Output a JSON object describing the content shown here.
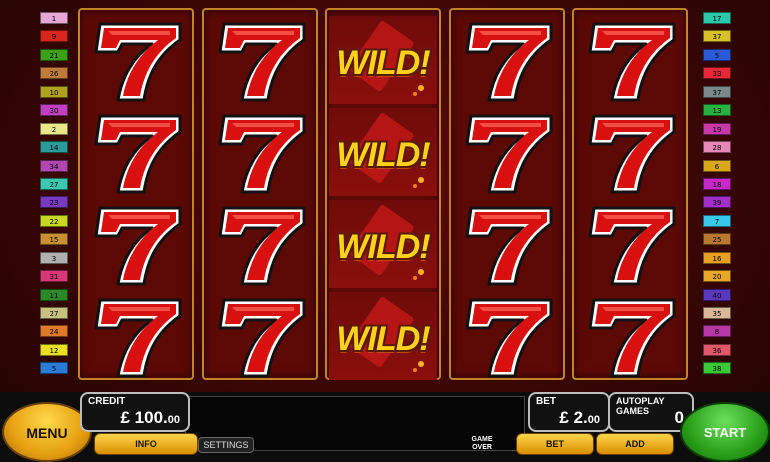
{
  "paylines": {
    "left": [
      {
        "n": "1",
        "c": "#e6a8d6"
      },
      {
        "n": "9",
        "c": "#d8261c"
      },
      {
        "n": "21",
        "c": "#3aa018"
      },
      {
        "n": "26",
        "c": "#c07a3a"
      },
      {
        "n": "10",
        "c": "#b0a020"
      },
      {
        "n": "30",
        "c": "#c040c0"
      },
      {
        "n": "2",
        "c": "#e8e88a"
      },
      {
        "n": "14",
        "c": "#2a9a9a"
      },
      {
        "n": "34",
        "c": "#b048b0"
      },
      {
        "n": "27",
        "c": "#3ac8b0"
      },
      {
        "n": "23",
        "c": "#7a3ac0"
      },
      {
        "n": "22",
        "c": "#c8d820"
      },
      {
        "n": "15",
        "c": "#c89030"
      },
      {
        "n": "3",
        "c": "#b0b0b0"
      },
      {
        "n": "31",
        "c": "#d83878"
      },
      {
        "n": "11",
        "c": "#2a8a2a"
      },
      {
        "n": "27",
        "c": "#c8c080"
      },
      {
        "n": "24",
        "c": "#e07a28"
      },
      {
        "n": "12",
        "c": "#e8e020"
      },
      {
        "n": "5",
        "c": "#2a7ad8"
      }
    ],
    "right": [
      {
        "n": "17",
        "c": "#2ac8a8"
      },
      {
        "n": "37",
        "c": "#d8c028"
      },
      {
        "n": "5",
        "c": "#2a5ad8"
      },
      {
        "n": "33",
        "c": "#e82838"
      },
      {
        "n": "37",
        "c": "#7a8a8a"
      },
      {
        "n": "13",
        "c": "#28b040"
      },
      {
        "n": "19",
        "c": "#c838a8"
      },
      {
        "n": "28",
        "c": "#e888b8"
      },
      {
        "n": "6",
        "c": "#d8a818"
      },
      {
        "n": "18",
        "c": "#c828c8"
      },
      {
        "n": "39",
        "c": "#a030c8"
      },
      {
        "n": "7",
        "c": "#38c8e8"
      },
      {
        "n": "25",
        "c": "#b87830"
      },
      {
        "n": "16",
        "c": "#e8a020"
      },
      {
        "n": "20",
        "c": "#e8a828"
      },
      {
        "n": "40",
        "c": "#5a38c0"
      },
      {
        "n": "35",
        "c": "#d8b898"
      },
      {
        "n": "8",
        "c": "#b838a8"
      },
      {
        "n": "36",
        "c": "#e0586a"
      },
      {
        "n": "38",
        "c": "#38c838"
      }
    ]
  },
  "reels": [
    [
      "seven",
      "seven",
      "seven",
      "seven"
    ],
    [
      "seven",
      "seven",
      "seven",
      "seven"
    ],
    [
      "wild",
      "wild",
      "wild",
      "wild"
    ],
    [
      "seven",
      "seven",
      "seven",
      "seven"
    ],
    [
      "seven",
      "seven",
      "seven",
      "seven"
    ]
  ],
  "symbols": {
    "wild_text": "WILD!"
  },
  "controls": {
    "menu": "MENU",
    "info": "INFO",
    "settings": "SETTINGS",
    "credit_label": "CREDIT",
    "credit_currency": "£",
    "credit_main": "100.",
    "credit_cents": "00",
    "game_over_line1": "GAME",
    "game_over_line2": "OVER",
    "bet_label": "BET",
    "bet_currency": "£",
    "bet_main": "2.",
    "bet_cents": "00",
    "bet_button": "BET",
    "autoplay_label": "AUTOPLAY GAMES",
    "autoplay_value": "0",
    "add_button": "ADD",
    "start": "START"
  },
  "colors": {
    "accent_gold": "#e6a010",
    "start_green": "#2aa01a",
    "seven_red": "#d81010"
  }
}
